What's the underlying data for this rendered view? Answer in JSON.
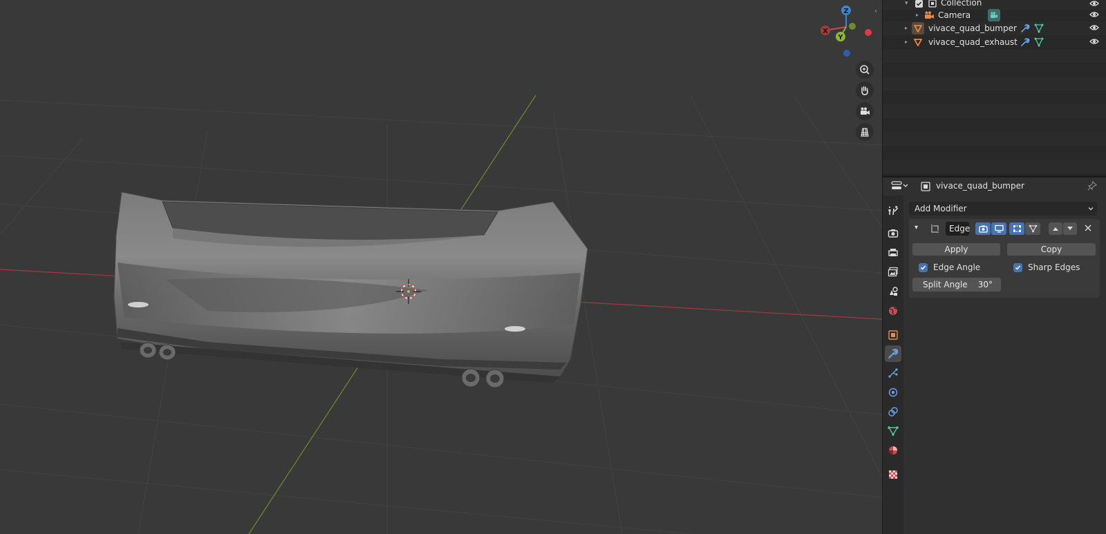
{
  "outliner": {
    "rows": [
      {
        "label": "Collection",
        "icon": "collection-icon"
      },
      {
        "label": "Camera",
        "icon": "camera-object-icon"
      },
      {
        "label": "vivace_quad_bumper",
        "icon": "mesh-object-icon"
      },
      {
        "label": "vivace_quad_exhaust",
        "icon": "mesh-object-icon"
      }
    ]
  },
  "viewport": {
    "gizmo": {
      "x": "X",
      "y": "Y",
      "z": "Z"
    },
    "nav_buttons": [
      "zoom-icon",
      "pan-hand-icon",
      "camera-view-icon",
      "orthographic-grid-icon"
    ]
  },
  "properties": {
    "object_name": "vivace_quad_bumper",
    "add_modifier": "Add Modifier",
    "modifier": {
      "name": "Edge",
      "apply_label": "Apply",
      "copy_label": "Copy",
      "edge_angle_label": "Edge Angle",
      "edge_angle_checked": true,
      "sharp_edges_label": "Sharp Edges",
      "sharp_edges_checked": true,
      "split_angle_label": "Split Angle",
      "split_angle_value": "30°"
    },
    "tabs": [
      "tool-icon",
      "render-icon",
      "output-icon",
      "view-layer-icon",
      "scene-icon",
      "world-icon",
      "object-icon",
      "modifier-wrench-icon",
      "particles-icon",
      "physics-icon",
      "constraints-icon",
      "object-data-icon",
      "material-icon",
      "texture-icon"
    ]
  },
  "colors": {
    "accent_blue": "#4772b3",
    "axis_x": "#c94a4a",
    "axis_y": "#8bb82e",
    "axis_z": "#3a86d8"
  }
}
